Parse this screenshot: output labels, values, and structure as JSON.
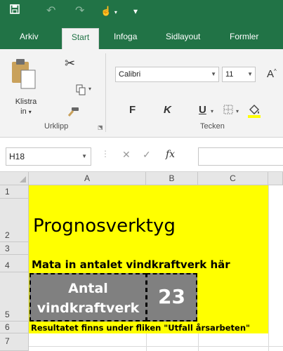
{
  "quick_access": {
    "save_icon": "save-icon",
    "undo_icon": "undo-icon",
    "redo_icon": "redo-icon",
    "touch_icon": "touch-mode-icon",
    "customize_icon": "customize-qat-icon"
  },
  "tabs": [
    {
      "label": "Arkiv"
    },
    {
      "label": "Start"
    },
    {
      "label": "Infoga"
    },
    {
      "label": "Sidlayout"
    },
    {
      "label": "Formler"
    }
  ],
  "ribbon": {
    "clipboard": {
      "paste_label": "Klistra",
      "paste_sub": "in",
      "paste_arrow": "▾",
      "group_label": "Urklipp"
    },
    "font": {
      "font_name": "Calibri",
      "font_size": "11",
      "bold": "F",
      "italic": "K",
      "underline": "U",
      "group_label": "Tecken"
    }
  },
  "formula_bar": {
    "name_box": "H18",
    "fx": "fx",
    "value": ""
  },
  "grid": {
    "columns": [
      "A",
      "B",
      "C"
    ],
    "rows": [
      "1",
      "2",
      "3",
      "4",
      "5",
      "6",
      "7"
    ],
    "cells": {
      "A2": "Prognosverktyg",
      "A4": "Mata in antalet vindkraftverk här",
      "A5_line1": "Antal",
      "A5_line2": "vindkraftverk",
      "B5": "23",
      "A6": "Resultatet finns under fliken \"Utfall årsarbeten\""
    }
  },
  "colors": {
    "brand_green": "#217346",
    "highlight_yellow": "#ffff00",
    "input_gray": "#808080"
  }
}
